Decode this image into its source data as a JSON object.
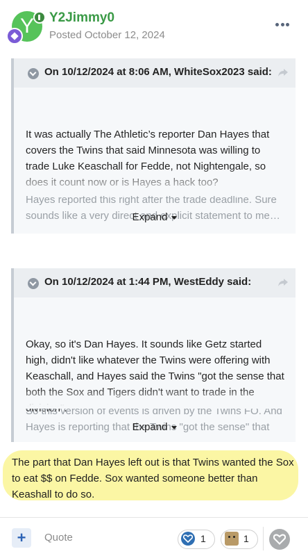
{
  "author": {
    "username": "Y2Jimmy0",
    "avatar_letter": "Y",
    "posted": "Posted October 12, 2024",
    "avatar_color": "#56c35a",
    "username_color": "#3a9a46"
  },
  "quotes": [
    {
      "header": "On 10/12/2024 at 8:06 AM, WhiteSox2023 said:",
      "paragraphs": [
        "It was actually The Athletic’s reporter Dan Hayes that covers the Twins that said Minnesota was willing to trade Luke Keaschall for Fedde, not Nightengale, so does it count now or is Hayes a hack too?",
        "Hayes reported this right after the trade deadline.  Sure sounds like a very direct and explicit statement to me…"
      ],
      "expand_label": "Expand"
    },
    {
      "header": "On 10/12/2024 at 1:44 PM, WestEddy said:",
      "paragraphs": [
        "Okay, so it's Dan Hayes. It sounds like Getz started high, didn't like whatever the Twins were offering with Keaschall, and Hayes said the Twins \"got the sense that both the Sox and Tigers didn't want to trade in the division\".",
        "So this version of events is driven by the Twins FO. And Hayes is reporting that the Twins \"got the sense\" that multiple teams didn't want to do that. You're assigning the"
      ],
      "expand_label": "Expand"
    }
  ],
  "body": {
    "text": "The part that Dan Hayes left out is that Twins wanted the Sox to eat $$ on Fedde. Sox wanted someone better than Keashall to do so.",
    "highlight_color": "#fbf6a4"
  },
  "footer": {
    "plus_label": "+",
    "quote_label": "Quote",
    "reactions": [
      {
        "icon": "like-heart-icon",
        "count": "1"
      },
      {
        "icon": "box-face-icon",
        "count": "1"
      }
    ]
  }
}
